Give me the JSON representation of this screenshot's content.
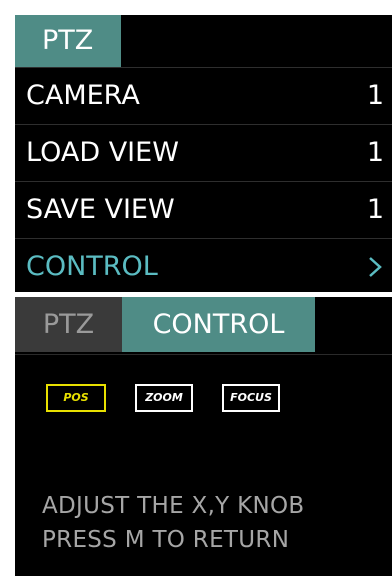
{
  "ptz_menu": {
    "tab_label": "PTZ",
    "items": [
      {
        "label": "CAMERA",
        "value": "1"
      },
      {
        "label": "LOAD VIEW",
        "value": "1"
      },
      {
        "label": "SAVE VIEW",
        "value": "1"
      },
      {
        "label": "CONTROL",
        "icon": "chevron-right-icon"
      }
    ],
    "colors": {
      "active_tab": "#4f8c86",
      "selected_text": "#5bbcc2",
      "background": "#000000"
    }
  },
  "control_panel": {
    "tabs": [
      {
        "label": "PTZ",
        "active": false
      },
      {
        "label": "CONTROL",
        "active": true
      }
    ],
    "modes": [
      {
        "label": "POS",
        "active": true
      },
      {
        "label": "ZOOM",
        "active": false
      },
      {
        "label": "FOCUS",
        "active": false
      }
    ],
    "instructions": [
      "ADJUST THE X,Y KNOB",
      "PRESS M TO RETURN"
    ],
    "colors": {
      "active_mode": "#e8e000",
      "inactive_tab": "#3a3a3a",
      "instruction_text": "#a6a6a6"
    }
  }
}
